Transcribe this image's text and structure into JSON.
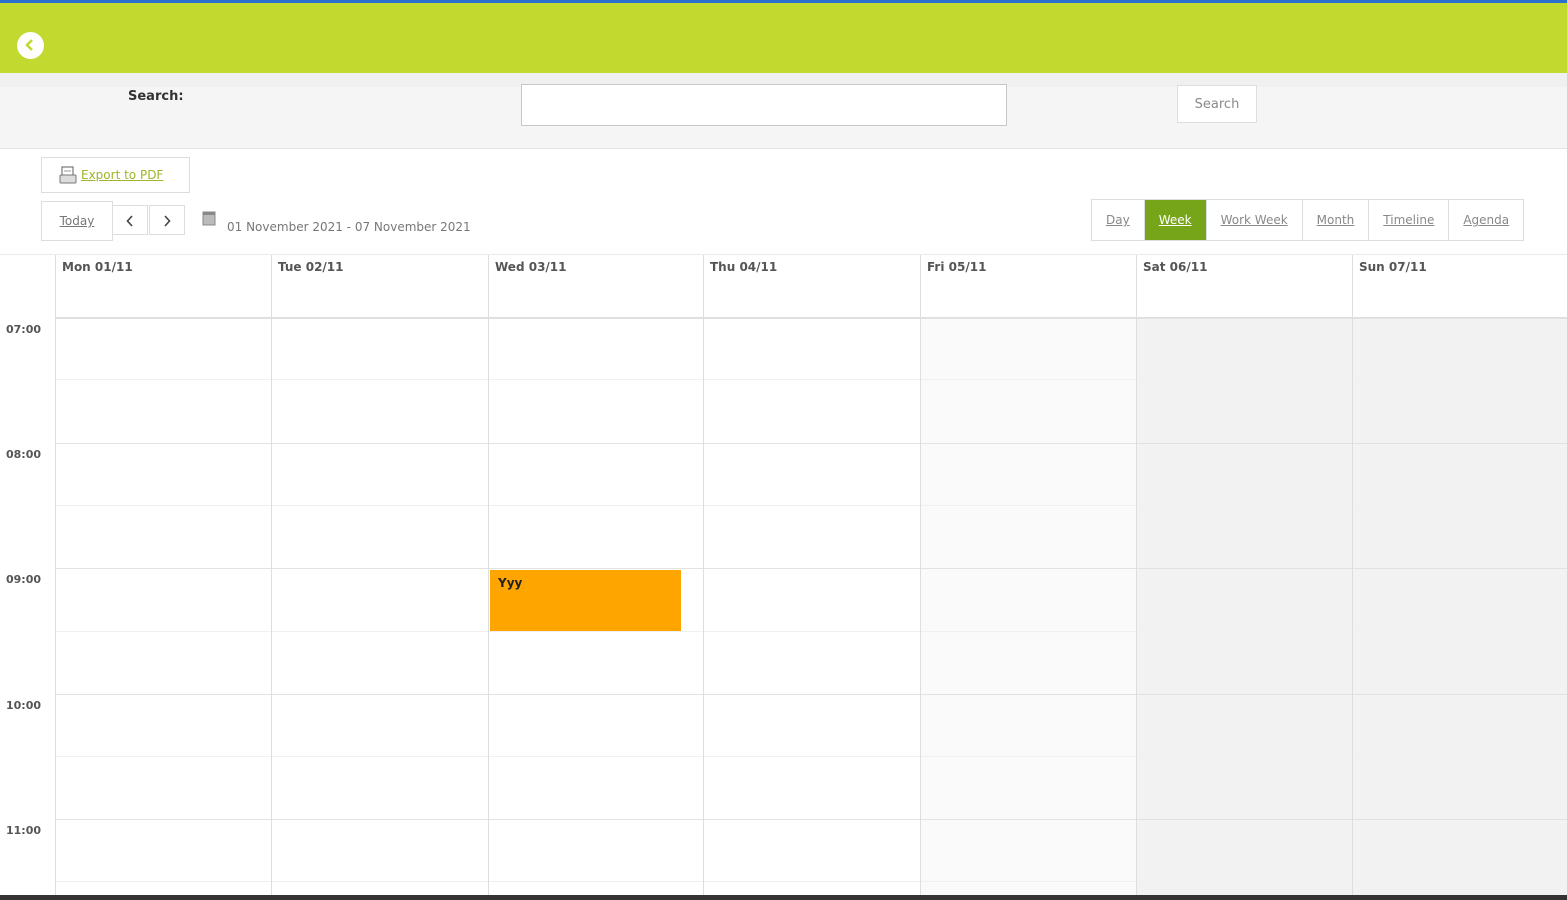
{
  "header": {
    "back_icon": "chevron-left-icon",
    "bar_color": "#c2d930"
  },
  "search": {
    "label": "Search:",
    "input_value": "",
    "button_label": "Search"
  },
  "export": {
    "label": "Export to PDF",
    "icon": "pdf-icon"
  },
  "toolbar": {
    "today_label": "Today",
    "prev_icon": "chevron-left-icon",
    "next_icon": "chevron-right-icon",
    "calendar_icon": "calendar-icon",
    "date_range": "01 November 2021 - 07 November 2021"
  },
  "views": [
    {
      "label": "Day",
      "active": false
    },
    {
      "label": "Week",
      "active": true
    },
    {
      "label": "Work Week",
      "active": false
    },
    {
      "label": "Month",
      "active": false
    },
    {
      "label": "Timeline",
      "active": false
    },
    {
      "label": "Agenda",
      "active": false
    }
  ],
  "days": [
    {
      "label": "Mon 01/11"
    },
    {
      "label": "Tue 02/11"
    },
    {
      "label": "Wed 03/11"
    },
    {
      "label": "Thu 04/11"
    },
    {
      "label": "Fri 05/11"
    },
    {
      "label": "Sat 06/11"
    },
    {
      "label": "Sun 07/11"
    }
  ],
  "times": [
    "07:00",
    "08:00",
    "09:00",
    "10:00",
    "11:00"
  ],
  "event": {
    "title": "Yyy",
    "day": "Wed 03/11",
    "start": "09:00",
    "end": "09:30",
    "color": "#ffa500"
  },
  "colors": {
    "active_view": "#77a51a",
    "link": "#9fb52a",
    "weekend": "#f2f2f2"
  }
}
